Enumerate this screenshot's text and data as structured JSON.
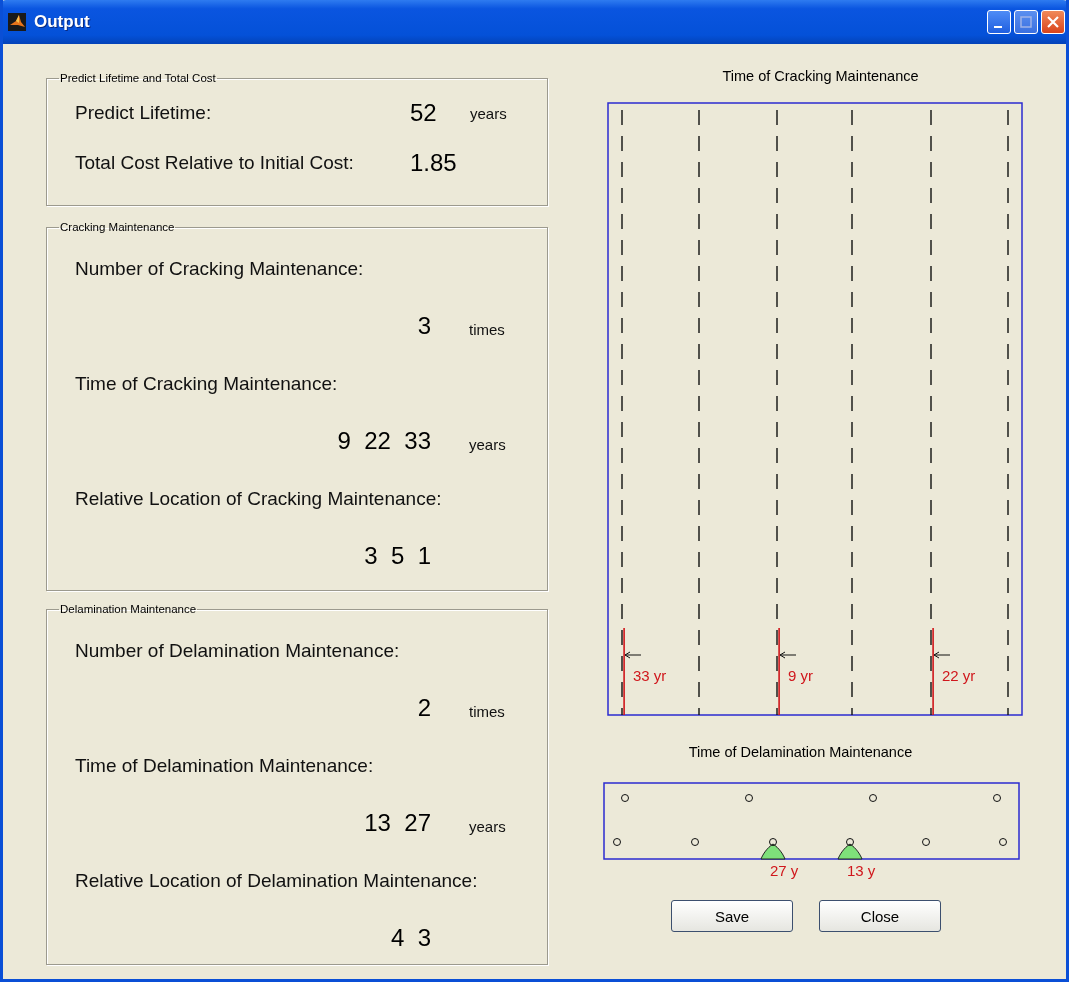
{
  "window": {
    "title": "Output"
  },
  "panels": [
    {
      "title": "Predict Lifetime and Total Cost",
      "rows": [
        {
          "kind": "inline",
          "label": "Predict Lifetime:",
          "value": "52",
          "unit": "years"
        },
        {
          "kind": "inline",
          "label": "Total Cost Relative to Initial Cost:",
          "value": "1.85"
        }
      ]
    },
    {
      "title": "Cracking Maintenance",
      "rows": [
        {
          "kind": "heading",
          "label": "Number of Cracking Maintenance:"
        },
        {
          "kind": "value",
          "value": "3",
          "unit": "times"
        },
        {
          "kind": "heading",
          "label": "Time of Cracking Maintenance:"
        },
        {
          "kind": "value",
          "value": "9  22  33",
          "unit": "years"
        },
        {
          "kind": "heading",
          "label": "Relative Location of Cracking Maintenance:"
        },
        {
          "kind": "value",
          "value": "3  5  1"
        }
      ]
    },
    {
      "title": "Delamination Maintenance",
      "rows": [
        {
          "kind": "heading",
          "label": "Number of Delamination Maintenance:"
        },
        {
          "kind": "value",
          "value": "2",
          "unit": "times"
        },
        {
          "kind": "heading",
          "label": "Time of Delamination Maintenance:"
        },
        {
          "kind": "value",
          "value": "13  27",
          "unit": "years"
        },
        {
          "kind": "heading",
          "label": "Relative Location of Delamination Maintenance:"
        },
        {
          "kind": "value",
          "value": "4  3"
        }
      ]
    }
  ],
  "cracking_plot": {
    "title": "Time of Cracking Maintenance",
    "columns": [
      {
        "marked": true,
        "label": "33 yr"
      },
      {
        "marked": false
      },
      {
        "marked": true,
        "label": "9 yr"
      },
      {
        "marked": false
      },
      {
        "marked": true,
        "label": "22 yr"
      },
      {
        "marked": false
      }
    ]
  },
  "delamination_plot": {
    "title": "Time of Delamination Maintenance",
    "top_row": [
      {
        "marked": false
      },
      {
        "marked": false
      },
      {
        "marked": false
      },
      {
        "marked": false
      }
    ],
    "bottom_row": [
      {
        "marked": false
      },
      {
        "marked": false
      },
      {
        "marked": true,
        "label": "27 y"
      },
      {
        "marked": true,
        "label": "13 y"
      },
      {
        "marked": false
      },
      {
        "marked": false
      }
    ]
  },
  "buttons": [
    "Save",
    "Close"
  ]
}
